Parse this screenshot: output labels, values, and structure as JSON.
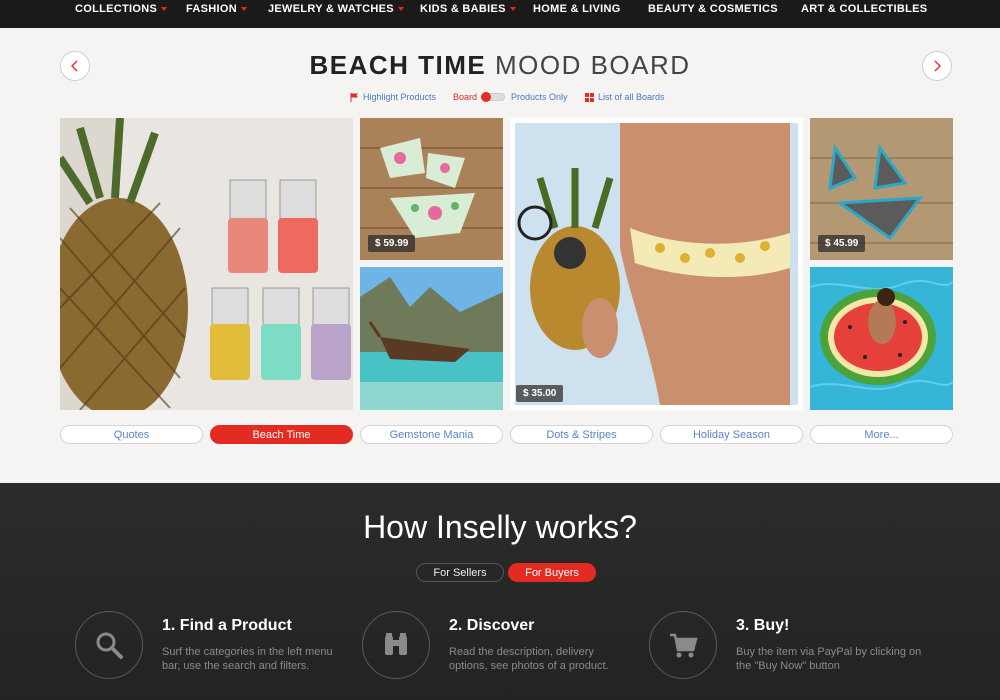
{
  "nav": {
    "items": [
      {
        "label": "COLLECTIONS",
        "dropdown": true
      },
      {
        "label": "FASHION",
        "dropdown": true
      },
      {
        "label": "JEWELRY & WATCHES",
        "dropdown": true
      },
      {
        "label": "KIDS & BABIES",
        "dropdown": true
      },
      {
        "label": "HOME & LIVING",
        "dropdown": false
      },
      {
        "label": "BEAUTY & COSMETICS",
        "dropdown": false
      },
      {
        "label": "ART & COLLECTIBLES",
        "dropdown": false
      }
    ]
  },
  "board": {
    "title_strong": "BEACH TIME",
    "title_light": "MOOD BOARD",
    "links": {
      "highlight": "Highlight Products",
      "board": "Board",
      "products_only": "Products Only",
      "list_all": "List of all Boards"
    },
    "tiles": {
      "pineapple_polish": {
        "alt": "pineapple and nail polish"
      },
      "floral_bikini": {
        "price": "$ 59.99"
      },
      "boat_beach": {
        "alt": "boat on tropical beach"
      },
      "pineapple_bikini": {
        "price": "$ 35.00"
      },
      "gray_bikini": {
        "price": "$ 45.99"
      },
      "watermelon_float": {
        "alt": "watermelon pool float"
      }
    },
    "tabs": [
      {
        "label": "Quotes",
        "active": false
      },
      {
        "label": "Beach Time",
        "active": true
      },
      {
        "label": "Gemstone Mania",
        "active": false
      },
      {
        "label": "Dots & Stripes",
        "active": false
      },
      {
        "label": "Holiday Season",
        "active": false
      },
      {
        "label": "More...",
        "active": false
      }
    ]
  },
  "how": {
    "title": "How Inselly works?",
    "tabs": {
      "sellers": "For Sellers",
      "buyers": "For Buyers"
    },
    "steps": [
      {
        "title": "1. Find a Product",
        "desc": "Surf the categories in the left menu bar, use the search and filters.",
        "icon": "search-icon"
      },
      {
        "title": "2. Discover",
        "desc": "Read the description, delivery options, see photos of a product.",
        "icon": "binoculars-icon"
      },
      {
        "title": "3. Buy!",
        "desc": "Buy the item via PayPal by clicking on the \"Buy Now\" button",
        "icon": "cart-icon"
      }
    ]
  },
  "colors": {
    "accent": "#e32b22",
    "link": "#4a78c8",
    "nav_bg": "#1a1a1a",
    "footer_bg": "#2b2b2b"
  }
}
